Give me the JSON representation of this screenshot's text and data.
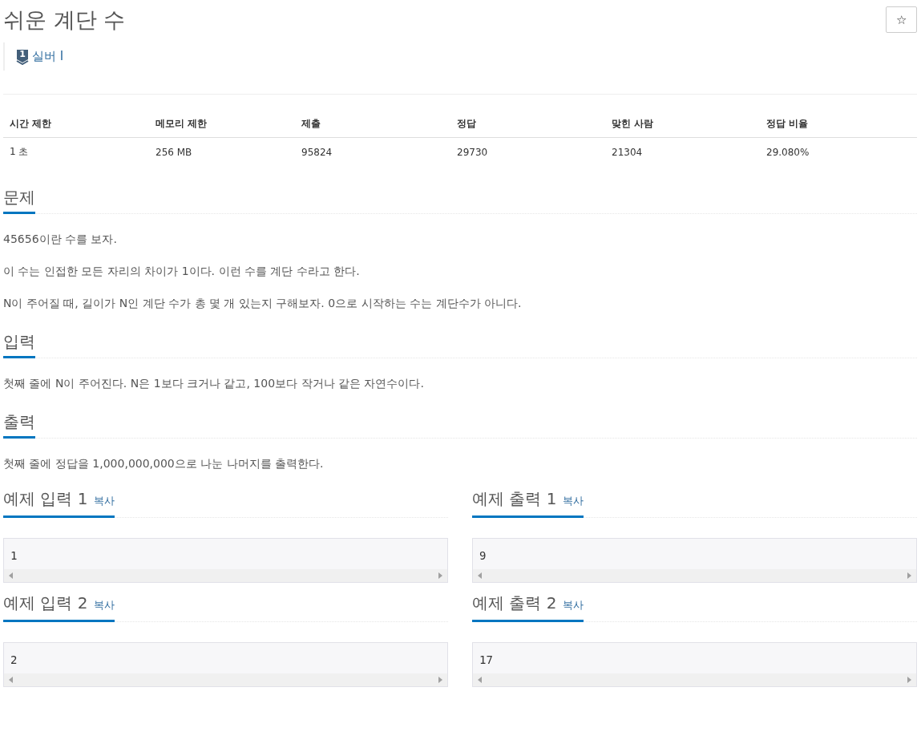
{
  "problem": {
    "title": "쉬운 계단 수",
    "favorite_button": "☆",
    "tier": {
      "badge": "1",
      "label": "실버 I"
    }
  },
  "stats": {
    "columns": [
      "시간 제한",
      "메모리 제한",
      "제출",
      "정답",
      "맞힌 사람",
      "정답 비율"
    ],
    "values": [
      "1 초",
      "256 MB",
      "95824",
      "29730",
      "21304",
      "29.080%"
    ]
  },
  "sections": [
    {
      "heading": "문제",
      "paragraphs": [
        "45656이란 수를 보자.",
        "이 수는 인접한 모든 자리의 차이가 1이다. 이런 수를 계단 수라고 한다.",
        "N이 주어질 때, 길이가 N인 계단 수가 총 몇 개 있는지 구해보자. 0으로 시작하는 수는 계단수가 아니다."
      ]
    },
    {
      "heading": "입력",
      "paragraphs": [
        "첫째 줄에 N이 주어진다. N은 1보다 크거나 같고, 100보다 작거나 같은 자연수이다."
      ]
    },
    {
      "heading": "출력",
      "paragraphs": [
        "첫째 줄에 정답을 1,000,000,000으로 나눈 나머지를 출력한다."
      ]
    }
  ],
  "samples": [
    {
      "heading": "예제 입력 1",
      "copy": "복사",
      "content": "1"
    },
    {
      "heading": "예제 출력 1",
      "copy": "복사",
      "content": "9"
    },
    {
      "heading": "예제 입력 2",
      "copy": "복사",
      "content": "2"
    },
    {
      "heading": "예제 출력 2",
      "copy": "복사",
      "content": "17"
    }
  ]
}
